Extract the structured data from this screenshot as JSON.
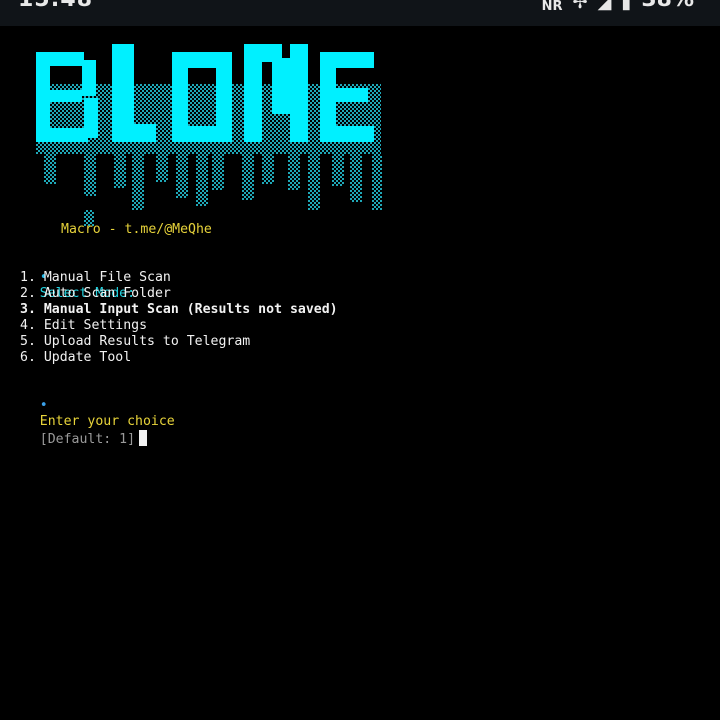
{
  "status_bar": {
    "time": "15:48",
    "nfc": "NR",
    "battery": "38%"
  },
  "banner": {
    "text": "BLONE",
    "color_main": "#00f0ff",
    "color_shade": "#1a8fa0"
  },
  "credit": "Macro - t.me/@MeQhe",
  "prompt_header": {
    "bullet": "•",
    "text": "Select Mode:"
  },
  "menu": {
    "items": [
      "1. Manual File Scan",
      "2. Auto Scan Folder",
      "3. Manual Input Scan (Results not saved)",
      "4. Edit Settings",
      "5. Upload Results to Telegram",
      "6. Update Tool"
    ]
  },
  "input_prompt": {
    "bullet": "•",
    "label": "Enter your choice",
    "default_hint": "[Default: 1]"
  }
}
